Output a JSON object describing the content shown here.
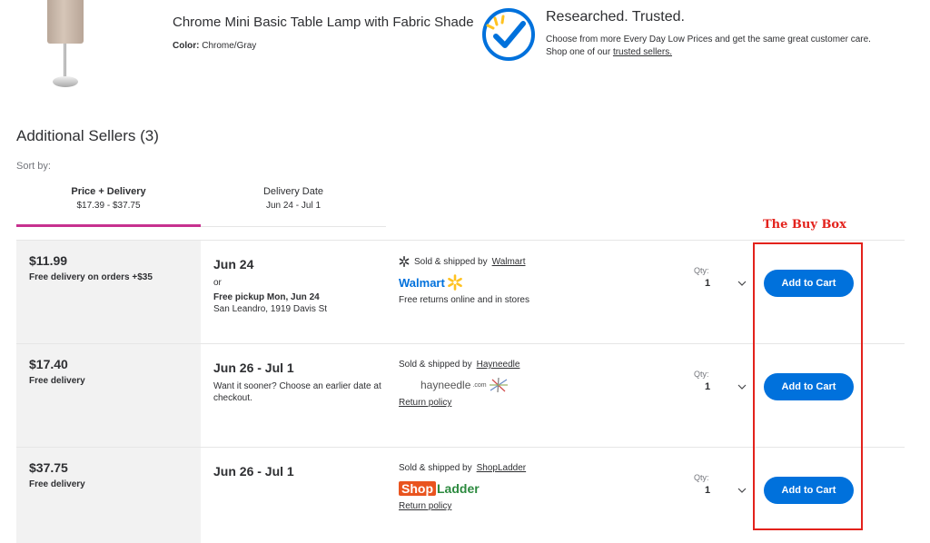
{
  "product": {
    "title": "Chrome Mini Basic Table Lamp with Fabric Shade",
    "color_label": "Color:",
    "color_value": "Chrome/Gray"
  },
  "trust": {
    "title": "Researched. Trusted.",
    "text": "Choose from more Every Day Low Prices and get the same great customer care. Shop one of our",
    "link": "trusted sellers.",
    "icon": "checkmark-spark-icon"
  },
  "sellers_section": {
    "title": "Additional Sellers (3)",
    "sort_label": "Sort by:"
  },
  "tabs": [
    {
      "label": "Price + Delivery",
      "sub": "$17.39 - $37.75",
      "active": true
    },
    {
      "label": "Delivery Date",
      "sub": "Jun 24 - Jul 1",
      "active": false
    }
  ],
  "annotation": {
    "buy_box_label": "The Buy Box",
    "color": "#e3221c"
  },
  "offers": [
    {
      "price": "$11.99",
      "price_note": "Free delivery on orders +$35",
      "date": "Jun 24",
      "date_or": "or",
      "pickup": "Free pickup Mon, Jun 24",
      "pickup_address": "San Leandro, 1919 Davis St",
      "sold_prefix": "Sold & shipped by",
      "seller": "Walmart",
      "logo_text": "Walmart",
      "extra": "Free returns online and in stores",
      "qty_label": "Qty:",
      "qty": "1",
      "cart_label": "Add to Cart"
    },
    {
      "price": "$17.40",
      "price_note": "Free delivery",
      "date": "Jun 26 - Jul 1",
      "date_note": "Want it sooner? Choose an earlier date at checkout.",
      "sold_prefix": "Sold & shipped by",
      "seller": "Hayneedle",
      "logo_text": "hayneedle",
      "logo_suffix": ".com",
      "extra": "Return policy",
      "qty_label": "Qty:",
      "qty": "1",
      "cart_label": "Add to Cart"
    },
    {
      "price": "$37.75",
      "price_note": "Free delivery",
      "date": "Jun 26 - Jul 1",
      "sold_prefix": "Sold & shipped by",
      "seller": "ShopLadder",
      "logo_shop": "Shop",
      "logo_ladder": "Ladder",
      "extra": "Return policy",
      "qty_label": "Qty:",
      "qty": "1",
      "cart_label": "Add to Cart"
    }
  ],
  "colors": {
    "accent_blue": "#0071dc",
    "tab_underline": "#c7318f",
    "spark_yellow": "#ffc220",
    "shop_orange": "#e9541f",
    "ladder_green": "#2c8a3f"
  }
}
